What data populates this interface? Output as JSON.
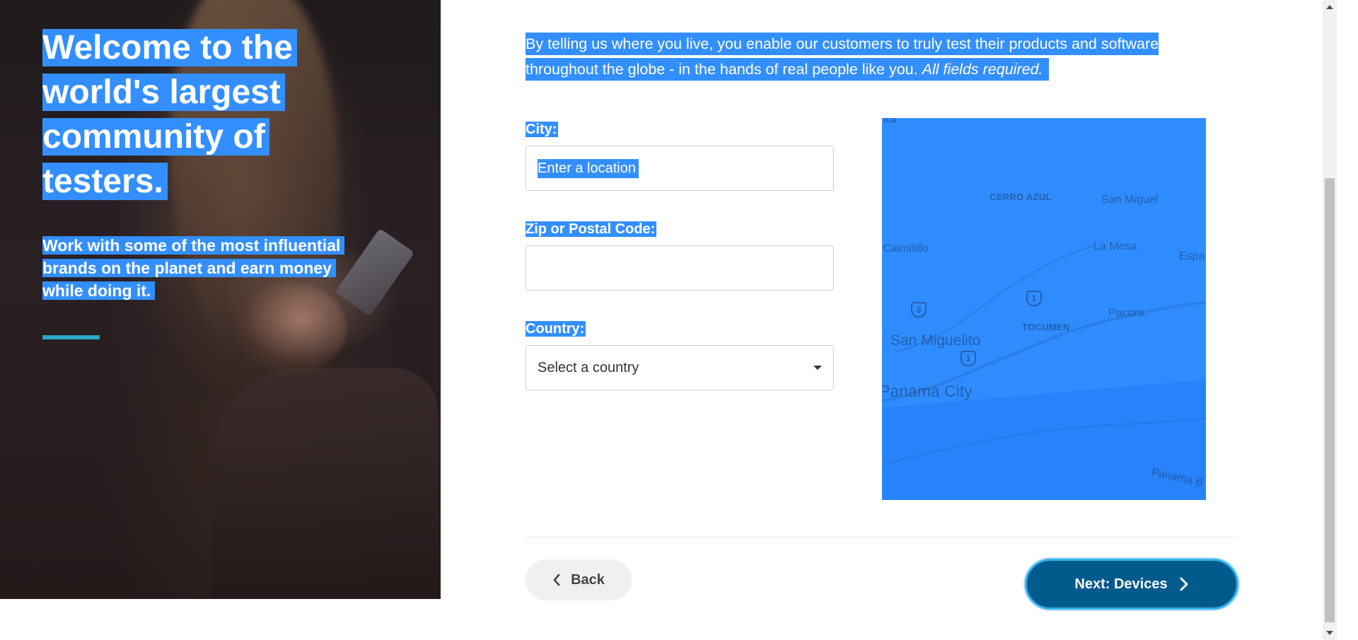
{
  "hero": {
    "title_lines": [
      "Welcome to the",
      "world's largest",
      "community of",
      "testers."
    ],
    "subtitle_lines": [
      "Work with some of the most influential",
      "brands on the planet and earn money",
      "while doing it."
    ],
    "accent_color": "#2aa9c4"
  },
  "intro": {
    "text": "By telling us where you live, you enable our customers to truly test their products and software throughout the globe - in the hands of real people like you.",
    "required_note": "All fields required."
  },
  "form": {
    "city_label": "City:",
    "city_placeholder": "Enter a location",
    "zip_label": "Zip or Postal Code:",
    "zip_value": "",
    "country_label": "Country:",
    "country_selected": "Select a country"
  },
  "map": {
    "labels": {
      "top_cut": "ica",
      "cerro_azul": "CERRO AZUL",
      "san_miguel": "San Miguel",
      "caimitillo": "Caimitillo",
      "la_mesa": "La Mesa",
      "espa": "Espa",
      "pacora": "Pacora",
      "tocumen": "TOCUMEN",
      "san_miguelito": "San Miguelito",
      "panama_city": "Panama City",
      "panama_bay": "Panama B"
    },
    "route_shields": [
      "3",
      "1",
      "1"
    ],
    "overlay_color": "#2f8cff"
  },
  "footer": {
    "back_label": "Back",
    "next_label": "Next: Devices",
    "next_color": "#005a8c"
  },
  "colors": {
    "selection": "#338fff"
  }
}
